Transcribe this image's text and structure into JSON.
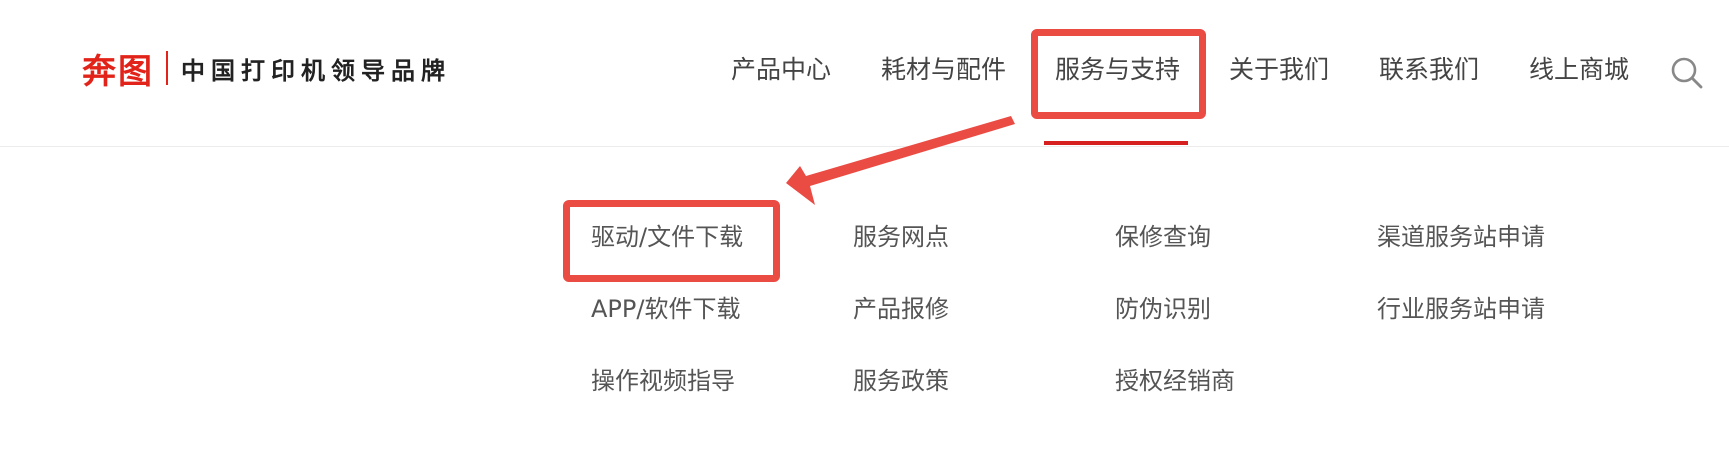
{
  "header": {
    "logo": {
      "brand": "奔图",
      "slogan": "中国打印机领导品牌"
    },
    "nav": [
      {
        "label": "产品中心"
      },
      {
        "label": "耗材与配件"
      },
      {
        "label": "服务与支持"
      },
      {
        "label": "关于我们"
      },
      {
        "label": "联系我们"
      },
      {
        "label": "线上商城"
      }
    ],
    "search_icon": "search-icon",
    "active_nav_index": 2,
    "accent_color": "#d61f1f"
  },
  "submenu": {
    "columns": [
      [
        "驱动/文件下载",
        "APP/软件下载",
        "操作视频指导"
      ],
      [
        "服务网点",
        "产品报修",
        "服务政策"
      ],
      [
        "保修查询",
        "防伪识别",
        "授权经销商"
      ],
      [
        "渠道服务站申请",
        "行业服务站申请"
      ]
    ]
  },
  "annotations": {
    "highlight_color": "#ea4b43"
  }
}
